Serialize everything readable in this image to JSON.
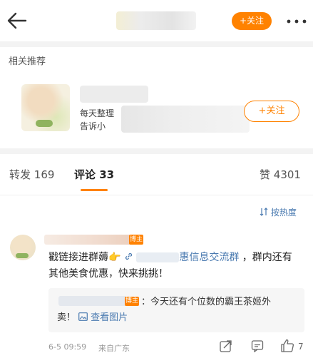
{
  "header": {
    "follow_label": "+关注"
  },
  "recommend": {
    "section_title": "相关推荐",
    "desc_line1": "每天整理",
    "desc_line2": "告诉小",
    "follow_label": "+关注"
  },
  "tabs": [
    {
      "label": "转发",
      "count": "169"
    },
    {
      "label": "评论",
      "count": "33"
    },
    {
      "label": "赞",
      "count": "4301"
    }
  ],
  "sort_toggle": "按热度",
  "comment": {
    "badge": "博主",
    "text_prefix": "戳链接进群薅",
    "link_suffix": "惠信息交流群",
    "text_suffix": "，群内还有其他美食优惠，快来挑挑！",
    "reply": {
      "badge": "博主",
      "text": "：今天还有个位数的霸王茶姬外",
      "text_line2": "卖！",
      "view_image_label": "查看图片"
    },
    "time": "6-5 09:59",
    "location": "来自广东",
    "like_count": "7"
  },
  "icons": {
    "back": "back-arrow-icon",
    "more": "more-dots-icon",
    "share": "share-icon",
    "comment": "comment-icon",
    "like": "thumbs-up-icon",
    "sort": "sort-icon",
    "link": "link-icon",
    "image": "image-icon"
  },
  "colors": {
    "accent": "#ff8200",
    "link": "#4a7ab0",
    "separator": "#f3f3f3"
  }
}
